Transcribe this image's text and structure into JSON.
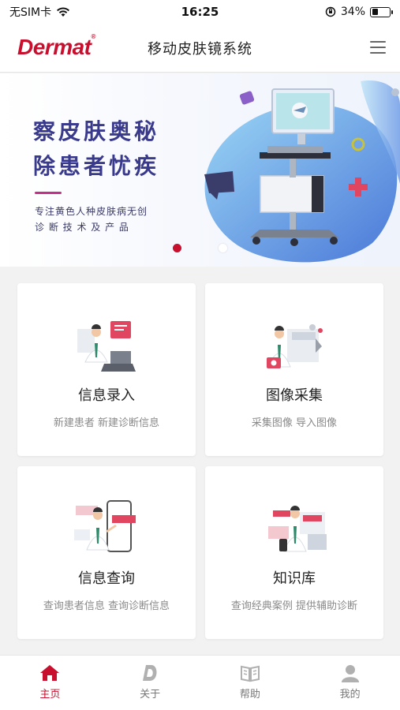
{
  "status": {
    "carrier": "无SIM卡",
    "time": "16:25",
    "battery": "34%",
    "battery_level": 0.34
  },
  "header": {
    "logo": "Dermat",
    "logo_mark": "®",
    "title": "移动皮肤镜系统"
  },
  "banner": {
    "headline_1": "察皮肤奥秘",
    "headline_2": "除患者忧疾",
    "sub_1": "专注黄色人种皮肤病无创",
    "sub_2": "诊 断 技 术 及 产 品"
  },
  "cards": [
    {
      "title": "信息录入",
      "desc": "新建患者 新建诊断信息"
    },
    {
      "title": "图像采集",
      "desc": "采集图像 导入图像"
    },
    {
      "title": "信息查询",
      "desc": "查询患者信息 查询诊断信息"
    },
    {
      "title": "知识库",
      "desc": "查询经典案例 提供辅助诊断"
    }
  ],
  "tabs": [
    {
      "label": "主页",
      "icon": "home-icon",
      "active": true
    },
    {
      "label": "关于",
      "icon": "dermat-d-icon",
      "active": false
    },
    {
      "label": "帮助",
      "icon": "book-icon",
      "active": false
    },
    {
      "label": "我的",
      "icon": "user-icon",
      "active": false
    }
  ],
  "colors": {
    "brand": "#c8102e",
    "banner_text": "#3a3a8c",
    "inactive_tab": "#b0b0b0"
  }
}
